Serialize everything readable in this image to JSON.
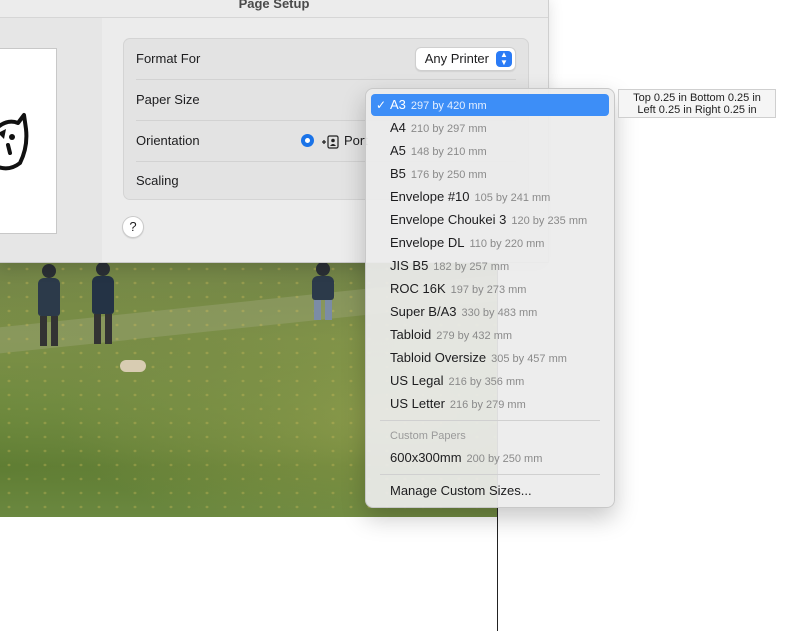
{
  "sheet": {
    "title": "Page Setup"
  },
  "form": {
    "format_for": {
      "label": "Format For",
      "value": "Any Printer"
    },
    "paper_size": {
      "label": "Paper Size"
    },
    "orientation": {
      "label": "Orientation",
      "option_label": "Port"
    },
    "scaling": {
      "label": "Scaling"
    },
    "help_label": "?"
  },
  "menu": {
    "items": [
      {
        "name": "A3",
        "dims": "297 by 420 mm",
        "selected": true
      },
      {
        "name": "A4",
        "dims": "210 by 297 mm"
      },
      {
        "name": "A5",
        "dims": "148 by 210 mm"
      },
      {
        "name": "B5",
        "dims": "176 by 250 mm"
      },
      {
        "name": "Envelope #10",
        "dims": "105 by 241 mm"
      },
      {
        "name": "Envelope Choukei 3",
        "dims": "120 by 235 mm"
      },
      {
        "name": "Envelope DL",
        "dims": "110 by 220 mm"
      },
      {
        "name": "JIS B5",
        "dims": "182 by 257 mm"
      },
      {
        "name": "ROC 16K",
        "dims": "197 by 273 mm"
      },
      {
        "name": "Super B/A3",
        "dims": "330 by 483 mm"
      },
      {
        "name": "Tabloid",
        "dims": "279 by 432 mm"
      },
      {
        "name": "Tabloid Oversize",
        "dims": "305 by 457 mm"
      },
      {
        "name": "US Legal",
        "dims": "216 by 356 mm"
      },
      {
        "name": "US Letter",
        "dims": "216 by 279 mm"
      }
    ],
    "custom_header": "Custom Papers",
    "custom_item": {
      "name": "600x300mm",
      "dims": "200 by 250 mm"
    },
    "manage": "Manage Custom Sizes...",
    "checkmark": "✓"
  },
  "margins": {
    "line1": "Top 0.25 in  Bottom 0.25 in",
    "line2": "Left 0.25 in  Right 0.25 in"
  },
  "colors": {
    "accent": "#3d8ef7",
    "panel": "#ececec"
  }
}
